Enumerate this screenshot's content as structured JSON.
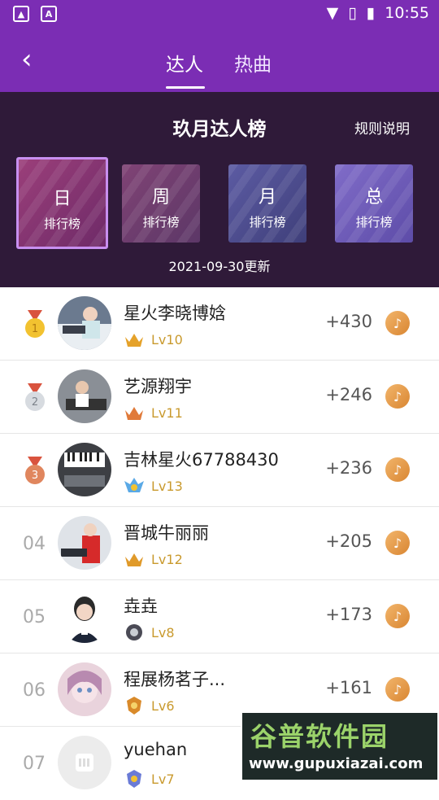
{
  "status_bar": {
    "time": "10:55"
  },
  "nav": {
    "tabs": [
      "达人",
      "热曲"
    ]
  },
  "banner": {
    "title": "玖月达人榜",
    "rules_link": "规则说明",
    "rank_cards": [
      {
        "big": "日",
        "small": "排行榜"
      },
      {
        "big": "周",
        "small": "排行榜"
      },
      {
        "big": "月",
        "small": "排行榜"
      },
      {
        "big": "总",
        "small": "排行榜"
      }
    ],
    "updated": "2021-09-30更新"
  },
  "list": [
    {
      "rank": "",
      "name": "星火李晓博娢",
      "level": "Lv10",
      "score": "+430"
    },
    {
      "rank": "",
      "name": "艺源翔宇",
      "level": "Lv11",
      "score": "+246"
    },
    {
      "rank": "",
      "name": "吉林星火67788430",
      "level": "Lv13",
      "score": "+236"
    },
    {
      "rank": "04",
      "name": "晋城牛丽丽",
      "level": "Lv12",
      "score": "+205"
    },
    {
      "rank": "05",
      "name": "垚垚",
      "level": "Lv8",
      "score": "+173"
    },
    {
      "rank": "06",
      "name": "程展杨茗子...",
      "level": "Lv6",
      "score": "+161"
    },
    {
      "rank": "07",
      "name": "yuehan",
      "level": "Lv7",
      "score": ""
    }
  ],
  "medal_labels": [
    "1",
    "2",
    "3"
  ],
  "watermark": {
    "title": "谷普软件园",
    "url": "www.gupuxiazai.com"
  },
  "colors": {
    "primary": "#7b2db4",
    "banner_bg": "#2f1a39",
    "level_text": "#c99a2e"
  }
}
